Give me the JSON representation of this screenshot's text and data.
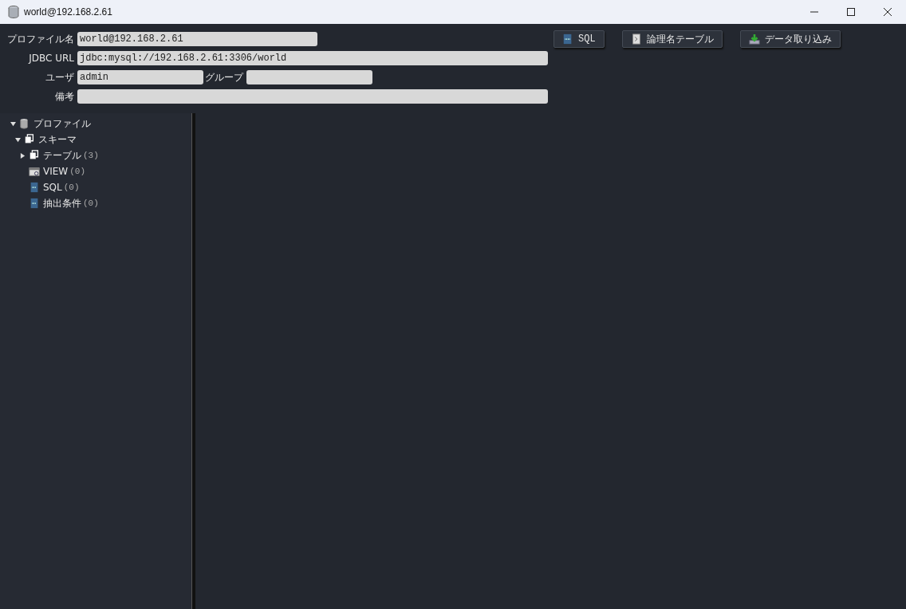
{
  "window": {
    "title": "world@192.168.2.61"
  },
  "form": {
    "profile_name": {
      "label": "プロファイル名",
      "value": "world@192.168.2.61"
    },
    "jdbc_url": {
      "label": "JDBC URL",
      "value": "jdbc:mysql://192.168.2.61:3306/world"
    },
    "user": {
      "label": "ユーザ",
      "value": "admin"
    },
    "group": {
      "label": "グループ"
    },
    "note": {
      "label": "備考"
    }
  },
  "buttons": [
    {
      "label": "SQL",
      "kind": "sql"
    },
    {
      "label": "論理名テーブル",
      "kind": "table"
    },
    {
      "label": "データ取り込み",
      "kind": "import"
    }
  ],
  "tree": [
    {
      "label": "プロファイル",
      "kind": "database",
      "expanded": true,
      "children": [
        {
          "label": "スキーマ",
          "kind": "schema",
          "expanded": true,
          "children": [
            {
              "label": "テーブル",
              "count": "(3)",
              "kind": "schema",
              "expanded": false
            },
            {
              "label": "VIEW",
              "count": "(0)",
              "kind": "view"
            },
            {
              "label": "SQL",
              "count": "(0)",
              "kind": "sql"
            },
            {
              "label": "抽出条件",
              "count": "(0)",
              "kind": "sql"
            }
          ]
        }
      ]
    }
  ]
}
